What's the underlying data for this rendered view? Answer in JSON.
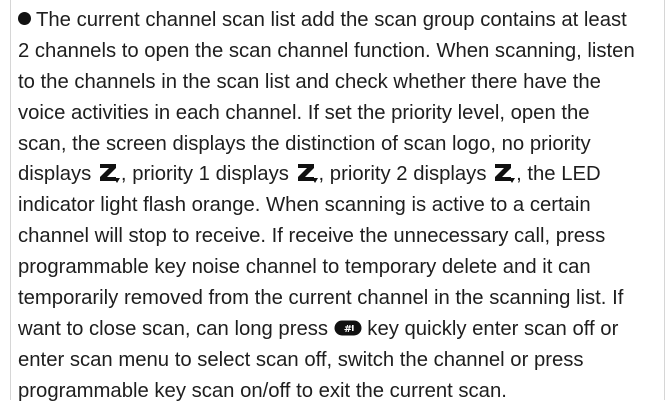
{
  "paragraph": {
    "l1": "The current channel scan list add the scan group contains at least",
    "l2": "2 channels to open the scan channel function. When scanning, listen",
    "l3": "to the channels in the scan list and check whether there have the",
    "l4": "voice activities in each channel. If set the priority level, open the",
    "l5": "scan, the screen displays the distinction of scan logo, no priority",
    "l6a": "displays ",
    "l6b": ", priority 1 displays ",
    "l6c": ", priority 2 displays ",
    "l6d": ", the LED",
    "l7": "indicator light flash orange. When scanning is active to a certain",
    "l8": "channel will stop to receive. If receive the unnecessary call, press",
    "l9": "programmable key noise channel to temporary delete and it can",
    "l10": "temporarily removed from the current channel in the scanning list. If",
    "l11a": "want to close scan, can long press ",
    "l11b": " key quickly enter scan off or",
    "l12": "enter scan menu to select scan off, switch the channel or press",
    "l13": "programmable key scan on/off to exit the current scan."
  },
  "icons": {
    "bullet": "filled-circle-bullet",
    "scan_no_priority": "scan-z-icon",
    "scan_priority_1": "scan-z-priority-1-icon",
    "scan_priority_2": "scan-z-priority-2-icon",
    "hash_key": "hash-key-icon"
  },
  "colors": {
    "text": "#1e1e1e",
    "icon": "#111111",
    "background": "#ffffff"
  }
}
